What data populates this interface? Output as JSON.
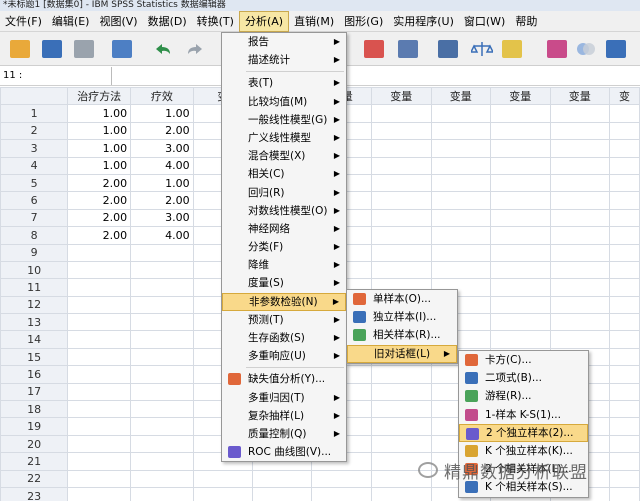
{
  "window": {
    "title": "*未标题1 [数据集0] - IBM SPSS Statistics 数据编辑器"
  },
  "menubar": [
    {
      "label": "文件(F)"
    },
    {
      "label": "编辑(E)"
    },
    {
      "label": "视图(V)"
    },
    {
      "label": "数据(D)"
    },
    {
      "label": "转换(T)"
    },
    {
      "label": "分析(A)"
    },
    {
      "label": "直销(M)"
    },
    {
      "label": "图形(G)"
    },
    {
      "label": "实用程序(U)"
    },
    {
      "label": "窗口(W)"
    },
    {
      "label": "帮助"
    }
  ],
  "refbar": {
    "cell_ref": "11 :",
    "value": ""
  },
  "grid": {
    "columns": [
      "治疗方法",
      "疗效",
      "变",
      "变量",
      "变量",
      "变量",
      "变量",
      "变量",
      "变量",
      "变"
    ],
    "rows": [
      {
        "n": "1",
        "a": "1.00",
        "b": "1.00"
      },
      {
        "n": "2",
        "a": "1.00",
        "b": "2.00"
      },
      {
        "n": "3",
        "a": "1.00",
        "b": "3.00"
      },
      {
        "n": "4",
        "a": "1.00",
        "b": "4.00"
      },
      {
        "n": "5",
        "a": "2.00",
        "b": "1.00"
      },
      {
        "n": "6",
        "a": "2.00",
        "b": "2.00"
      },
      {
        "n": "7",
        "a": "2.00",
        "b": "3.00"
      },
      {
        "n": "8",
        "a": "2.00",
        "b": "4.00"
      },
      {
        "n": "9",
        "a": "",
        "b": ""
      },
      {
        "n": "10",
        "a": "",
        "b": ""
      },
      {
        "n": "11",
        "a": "",
        "b": ""
      },
      {
        "n": "12",
        "a": "",
        "b": ""
      },
      {
        "n": "13",
        "a": "",
        "b": ""
      },
      {
        "n": "14",
        "a": "",
        "b": ""
      },
      {
        "n": "15",
        "a": "",
        "b": ""
      },
      {
        "n": "16",
        "a": "",
        "b": ""
      },
      {
        "n": "17",
        "a": "",
        "b": ""
      },
      {
        "n": "18",
        "a": "",
        "b": ""
      },
      {
        "n": "19",
        "a": "",
        "b": ""
      },
      {
        "n": "20",
        "a": "",
        "b": ""
      },
      {
        "n": "21",
        "a": "",
        "b": ""
      },
      {
        "n": "22",
        "a": "",
        "b": ""
      },
      {
        "n": "23",
        "a": "",
        "b": ""
      }
    ]
  },
  "analyze_menu": [
    {
      "label": "报告",
      "sub": true
    },
    {
      "label": "描述统计",
      "sub": true
    },
    {
      "label": "表(T)",
      "sub": true
    },
    {
      "label": "比较均值(M)",
      "sub": true
    },
    {
      "label": "一般线性模型(G)",
      "sub": true
    },
    {
      "label": "广义线性模型",
      "sub": true
    },
    {
      "label": "混合模型(X)",
      "sub": true
    },
    {
      "label": "相关(C)",
      "sub": true
    },
    {
      "label": "回归(R)",
      "sub": true
    },
    {
      "label": "对数线性模型(O)",
      "sub": true
    },
    {
      "label": "神经网络",
      "sub": true
    },
    {
      "label": "分类(F)",
      "sub": true
    },
    {
      "label": "降维",
      "sub": true
    },
    {
      "label": "度量(S)",
      "sub": true
    },
    {
      "label": "非参数检验(N)",
      "sub": true,
      "highlight": true
    },
    {
      "label": "预测(T)",
      "sub": true
    },
    {
      "label": "生存函数(S)",
      "sub": true
    },
    {
      "label": "多重响应(U)",
      "sub": true
    },
    {
      "label": "缺失值分析(Y)...",
      "sub": false,
      "icon": "missing-value-icon"
    },
    {
      "label": "多重归因(T)",
      "sub": true
    },
    {
      "label": "复杂抽样(L)",
      "sub": true
    },
    {
      "label": "质量控制(Q)",
      "sub": true
    },
    {
      "label": "ROC 曲线图(V)...",
      "sub": false,
      "icon": "roc-curve-icon"
    }
  ],
  "nonpar_menu": [
    {
      "label": "单样本(O)...",
      "icon": "one-sample-icon"
    },
    {
      "label": "独立样本(I)...",
      "icon": "independent-samples-icon"
    },
    {
      "label": "相关样本(R)...",
      "icon": "related-samples-icon"
    },
    {
      "label": "旧对话框(L)",
      "sub": true,
      "highlight": true
    }
  ],
  "legacy_menu": [
    {
      "label": "卡方(C)...",
      "icon": "chi-square-icon"
    },
    {
      "label": "二项式(B)...",
      "icon": "binomial-icon"
    },
    {
      "label": "游程(R)...",
      "icon": "runs-icon"
    },
    {
      "label": "1-样本 K-S(1)...",
      "icon": "ks-one-sample-icon"
    },
    {
      "label": "2 个独立样本(2)...",
      "icon": "two-independent-icon",
      "highlight": true
    },
    {
      "label": "K 个独立样本(K)...",
      "icon": "k-independent-icon"
    },
    {
      "label": "2 个相关样本(L)...",
      "icon": "two-related-icon"
    },
    {
      "label": "K 个相关样本(S)...",
      "icon": "k-related-icon"
    }
  ],
  "watermark": "精鼎数据分析联盟",
  "colors": {
    "highlight": "#f9d98a",
    "header_bg": "#eef1f6",
    "menu_bg": "#f5f5f5"
  }
}
